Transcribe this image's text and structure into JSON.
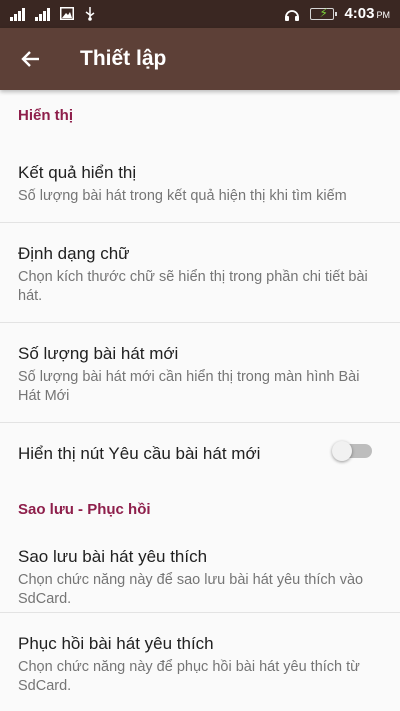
{
  "status_bar": {
    "time": "4:03",
    "ampm": "PM"
  },
  "app_bar": {
    "title": "Thiết lập"
  },
  "sections": {
    "display": {
      "header": "Hiển thị",
      "results": {
        "title": "Kết quả hiển thị",
        "summary": "Số lượng bài hát trong kết quả hiện thị khi tìm kiếm"
      },
      "font_format": {
        "title": "Định dạng chữ",
        "summary": "Chọn kích thước chữ sẽ hiển thị trong phần chi tiết bài hát."
      },
      "new_songs_count": {
        "title": "Số lượng bài hát mới",
        "summary": "Số lượng bài hát mới cần hiển thị trong màn hình Bài Hát Mới"
      },
      "request_button": {
        "title": "Hiển thị nút Yêu cầu bài hát mới",
        "enabled": false
      }
    },
    "backup": {
      "header": "Sao lưu - Phục hồi",
      "backup_favorites": {
        "title": "Sao lưu bài hát yêu thích",
        "summary": "Chọn chức năng này để sao lưu bài hát yêu thích vào SdCard."
      },
      "restore_favorites": {
        "title": "Phục hồi bài hát yêu thích",
        "summary": "Chọn chức năng này để phục hồi bài hát yêu thích từ SdCard."
      }
    }
  }
}
